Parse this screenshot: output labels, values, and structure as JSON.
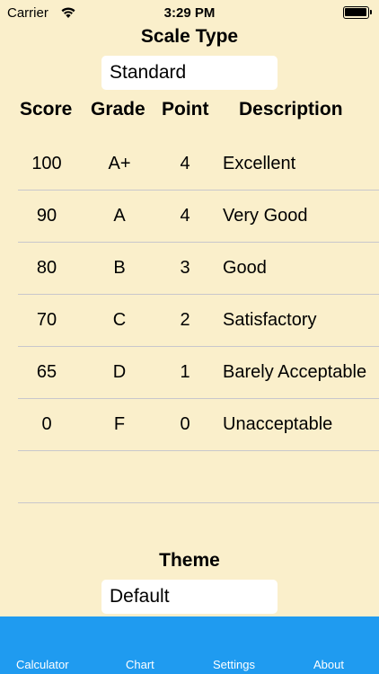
{
  "status": {
    "carrier": "Carrier",
    "time": "3:29 PM"
  },
  "scale": {
    "title": "Scale Type",
    "value": "Standard"
  },
  "table": {
    "headers": {
      "score": "Score",
      "grade": "Grade",
      "point": "Point",
      "description": "Description"
    },
    "rows": [
      {
        "score": "100",
        "grade": "A+",
        "point": "4",
        "description": "Excellent"
      },
      {
        "score": "90",
        "grade": "A",
        "point": "4",
        "description": "Very Good"
      },
      {
        "score": "80",
        "grade": "B",
        "point": "3",
        "description": "Good"
      },
      {
        "score": "70",
        "grade": "C",
        "point": "2",
        "description": "Satisfactory"
      },
      {
        "score": "65",
        "grade": "D",
        "point": "1",
        "description": "Barely Acceptable"
      },
      {
        "score": "0",
        "grade": "F",
        "point": "0",
        "description": "Unacceptable"
      },
      {
        "score": "",
        "grade": "",
        "point": "",
        "description": ""
      }
    ]
  },
  "theme": {
    "title": "Theme",
    "value": "Default"
  },
  "tabs": [
    {
      "label": "Calculator"
    },
    {
      "label": "Chart"
    },
    {
      "label": "Settings"
    },
    {
      "label": "About"
    }
  ],
  "colors": {
    "background": "#FAEFCB",
    "tab_bar": "#1F9BF0",
    "separator": "#C8C7CC"
  },
  "icons": {
    "wifi": "wifi-icon",
    "battery": "battery-icon"
  }
}
